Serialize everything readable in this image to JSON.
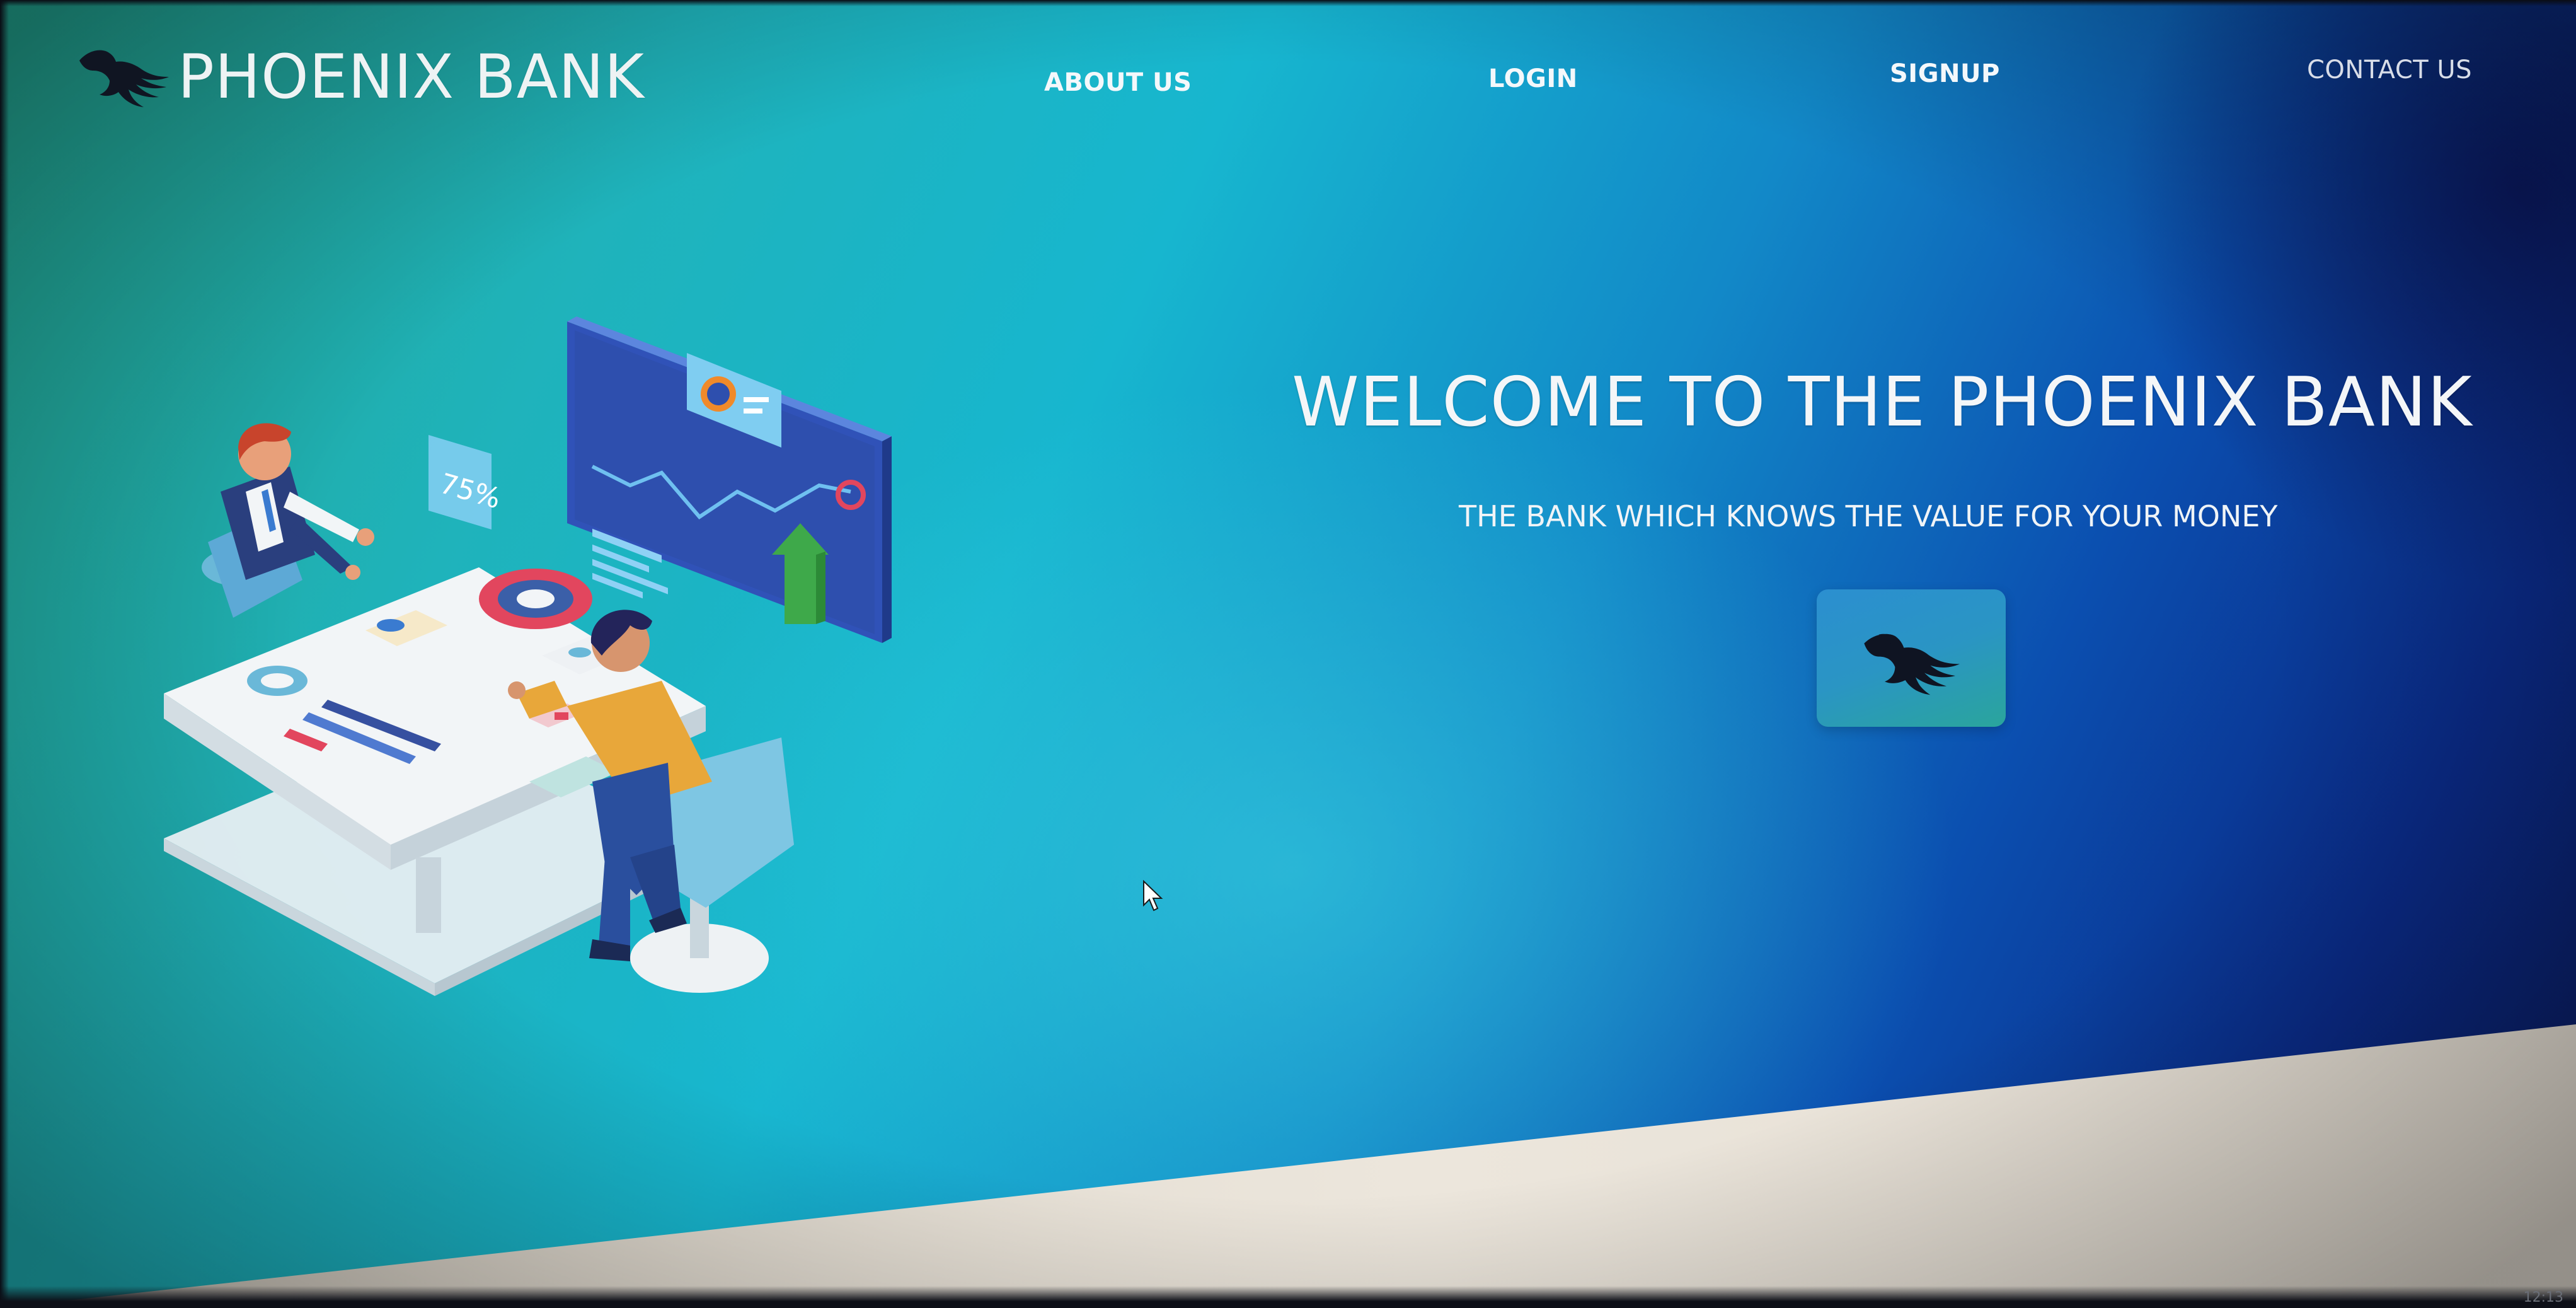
{
  "brand": {
    "name": "PHOENIX BANK",
    "logo_icon": "phoenix-bird-icon"
  },
  "nav": {
    "items": [
      {
        "label": "ABOUT US"
      },
      {
        "label": "LOGIN"
      },
      {
        "label": "SIGNUP"
      },
      {
        "label": "CONTACT US"
      }
    ]
  },
  "hero": {
    "title": "WELCOME TO THE PHOENIX BANK",
    "subtitle": "THE BANK WHICH KNOWS THE VALUE FOR YOUR MONEY",
    "button_icon": "phoenix-bird-icon",
    "illustration": {
      "icon": "business-meeting-illustration",
      "percent_card": "75%"
    }
  },
  "system": {
    "clock": "12:13"
  },
  "colors": {
    "gradient_left": "#22a48f",
    "gradient_mid": "#17b6cf",
    "gradient_right": "#0b1a5a",
    "text": "#f4f6f8",
    "bottom_band": "#e8e1d6"
  }
}
